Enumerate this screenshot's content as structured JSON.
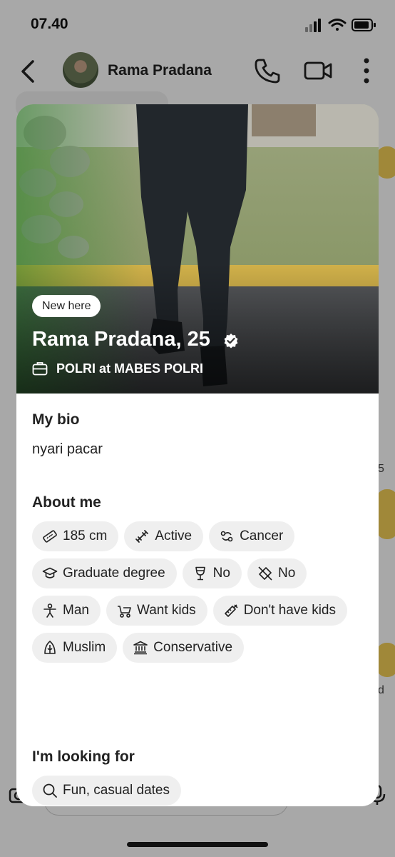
{
  "status_bar": {
    "time": "07.40"
  },
  "chat_header": {
    "contact_name": "Rama Pradana"
  },
  "background": {
    "side_number": "5",
    "side_letter": "d"
  },
  "profile": {
    "badge": "New here",
    "name_age": "Rama Pradana, 25",
    "job": "POLRI at MABES POLRI"
  },
  "bio": {
    "title": "My bio",
    "text": "nyari pacar"
  },
  "about": {
    "title": "About me",
    "chips": [
      {
        "label": "185 cm",
        "icon": "ruler-icon"
      },
      {
        "label": "Active",
        "icon": "dumbbell-icon"
      },
      {
        "label": "Cancer",
        "icon": "zodiac-icon"
      },
      {
        "label": "Graduate degree",
        "icon": "graduation-cap-icon"
      },
      {
        "label": "No",
        "icon": "wine-glass-icon"
      },
      {
        "label": "No",
        "icon": "cigarette-icon"
      },
      {
        "label": "Man",
        "icon": "person-icon"
      },
      {
        "label": "Want kids",
        "icon": "stroller-icon"
      },
      {
        "label": "Don't have kids",
        "icon": "baby-bottle-icon"
      },
      {
        "label": "Muslim",
        "icon": "religion-icon"
      },
      {
        "label": "Conservative",
        "icon": "government-building-icon"
      }
    ]
  },
  "looking_for": {
    "title": "I'm looking for",
    "chips": [
      {
        "label": "Fun, casual dates",
        "icon": "search-icon"
      }
    ]
  }
}
